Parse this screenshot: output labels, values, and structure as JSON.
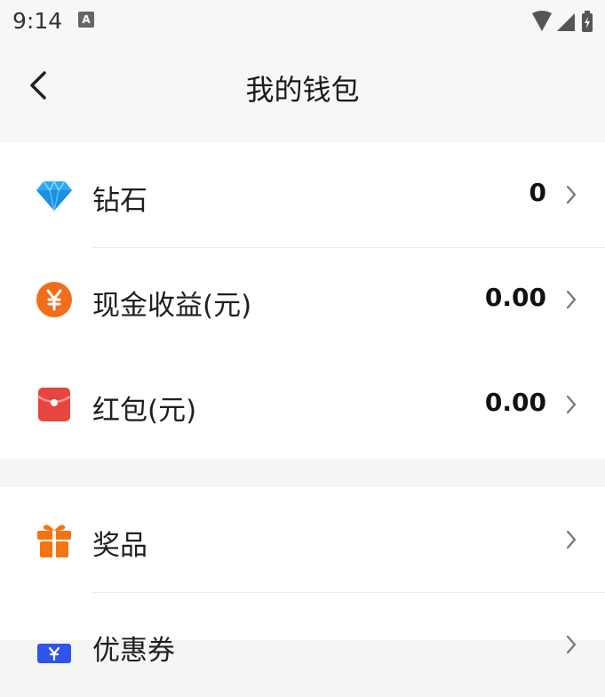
{
  "status_bar": {
    "time": "9:14",
    "badge": "A"
  },
  "header": {
    "title": "我的钱包"
  },
  "wallet_items": [
    {
      "label": "钻石",
      "value": "0",
      "icon": "diamond-icon"
    },
    {
      "label": "现金收益(元)",
      "value": "0.00",
      "icon": "yuan-coin-icon"
    },
    {
      "label": "红包(元)",
      "value": "0.00",
      "icon": "red-envelope-icon"
    }
  ],
  "other_items": [
    {
      "label": "奖品",
      "icon": "gift-icon"
    },
    {
      "label": "优惠券",
      "icon": "coupon-icon"
    }
  ],
  "colors": {
    "diamond": "#2aa8f5",
    "yuan": "#f26d1b",
    "envelope": "#e6463f",
    "gift": "#f5740f",
    "coupon": "#2f54eb"
  }
}
